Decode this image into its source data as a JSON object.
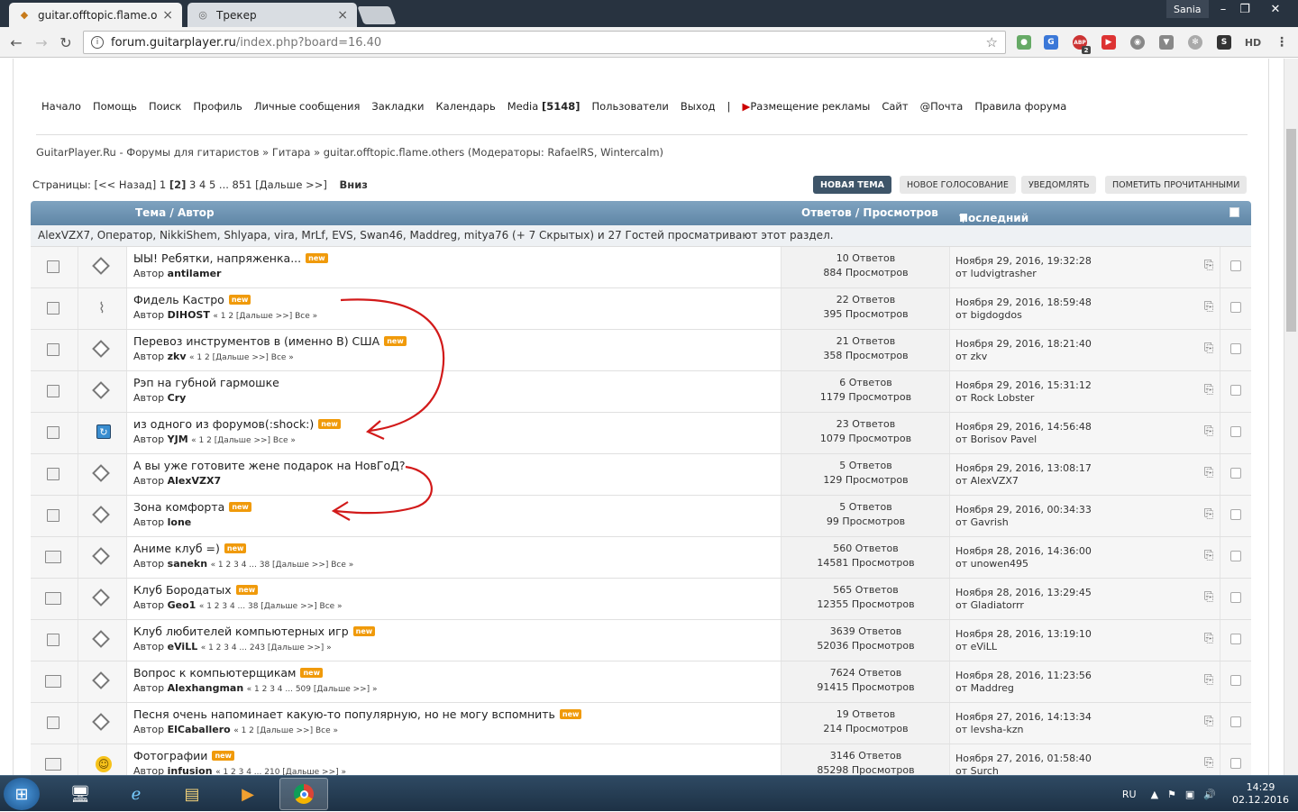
{
  "browser": {
    "tabs": [
      {
        "title": "guitar.offtopic.flame.othe",
        "active": true
      },
      {
        "title": "Трекер",
        "active": false
      }
    ],
    "user": "Sania",
    "url_host": "forum.guitarplayer.ru",
    "url_path": "/index.php?board=16.40",
    "ext_hd": "HD",
    "ext_abp": "ABP",
    "ext_abp_count": "2"
  },
  "menu": {
    "items": [
      "Начало",
      "Помощь",
      "Поиск",
      "Профиль",
      "Личные сообщения",
      "Закладки",
      "Календарь"
    ],
    "media_label": "Media",
    "media_count": "[5148]",
    "items2": [
      "Пользователи",
      "Выход"
    ],
    "sep": "|",
    "ads": "Размещение рекламы",
    "items3": [
      "Сайт",
      "@Почта",
      "Правила форума"
    ]
  },
  "breadcrumb": "GuitarPlayer.Ru - Форумы для гитаристов » Гитара » guitar.offtopic.flame.others (Модераторы: RafaelRS, Wintercalm)",
  "pagination": {
    "prefix": "Страницы: [<< Назад] 1 ",
    "current": "[2]",
    "rest": " 3 4 5 ... 851 [Дальше >>]",
    "down": "Вниз"
  },
  "buttons": {
    "new_topic": "НОВАЯ ТЕМА",
    "new_poll": "НОВОЕ ГОЛОСОВАНИЕ",
    "notify": "УВЕДОМЛЯТЬ",
    "mark_read": "ПОМЕТИТЬ ПРОЧИТАННЫМИ"
  },
  "table": {
    "col_topic": "Тема / Автор",
    "col_stats": "Ответов / Просмотров",
    "col_last": "Последний ответ",
    "viewers": "AlexVZX7, Оператор, NikkiShem, Shlyapa, vira, MrLf, EVS, Swan46, Maddreg, mitya76 (+ 7 Скрытых) и 27 Гостей просматривают этот раздел.",
    "author_prefix": "Автор",
    "new_badge": "new"
  },
  "topics": [
    {
      "title": "ЫЫ! Ребятки, напряженка...",
      "new": true,
      "author": "antilamer",
      "pages": "",
      "replies": "10 Ответов",
      "views": "884 Просмотров",
      "date": "Ноября 29, 2016, 19:32:28",
      "by": "от ludvigtrasher",
      "icon1": "doc",
      "icon2": "diamond"
    },
    {
      "title": "Фидель Кастро",
      "new": true,
      "author": "DIHOST",
      "pages": "« 1 2 [Дальше >>]   Все »",
      "replies": "22 Ответов",
      "views": "395 Просмотров",
      "date": "Ноября 29, 2016, 18:59:48",
      "by": "от bigdogdos",
      "icon1": "doc",
      "icon2": "clip"
    },
    {
      "title": "Перевоз инструментов в (именно В) США",
      "new": true,
      "author": "zkv",
      "pages": "« 1 2 [Дальше >>]   Все »",
      "replies": "21 Ответов",
      "views": "358 Просмотров",
      "date": "Ноября 29, 2016, 18:21:40",
      "by": "от zkv",
      "icon1": "doc",
      "icon2": "diamond"
    },
    {
      "title": "Рэп на губной гармошке",
      "new": false,
      "author": "Cry",
      "pages": "",
      "replies": "6 Ответов",
      "views": "1179 Просмотров",
      "date": "Ноября 29, 2016, 15:31:12",
      "by": "от Rock Lobster",
      "icon1": "doc",
      "icon2": "diamond"
    },
    {
      "title": "из одного из форумов(:shock:)",
      "new": true,
      "author": "YJM",
      "pages": "« 1 2 [Дальше >>]   Все »",
      "replies": "23 Ответов",
      "views": "1079 Просмотров",
      "date": "Ноября 29, 2016, 14:56:48",
      "by": "от Borisov Pavel",
      "icon1": "doc",
      "icon2": "refresh"
    },
    {
      "title": "А вы уже готовите жене подарок на НовГоД?",
      "new": false,
      "author": "AlexVZX7",
      "pages": "",
      "replies": "5 Ответов",
      "views": "129 Просмотров",
      "date": "Ноября 29, 2016, 13:08:17",
      "by": "от AlexVZX7",
      "icon1": "doc",
      "icon2": "diamond"
    },
    {
      "title": "Зона комфорта",
      "new": true,
      "author": "lone",
      "pages": "",
      "replies": "5 Ответов",
      "views": "99 Просмотров",
      "date": "Ноября 29, 2016, 00:34:33",
      "by": "от Gavrish",
      "icon1": "doc",
      "icon2": "diamond"
    },
    {
      "title": "Аниме клуб =)",
      "new": true,
      "author": "sanekn",
      "pages": "« 1 2 3 4 ... 38 [Дальше >>]   Все »",
      "replies": "560 Ответов",
      "views": "14581 Просмотров",
      "date": "Ноября 28, 2016, 14:36:00",
      "by": "от unowen495",
      "icon1": "big",
      "icon2": "diamond"
    },
    {
      "title": "Клуб Бородатых",
      "new": true,
      "author": "Geo1",
      "pages": "« 1 2 3 4 ... 38 [Дальше >>]   Все »",
      "replies": "565 Ответов",
      "views": "12355 Просмотров",
      "date": "Ноября 28, 2016, 13:29:45",
      "by": "от Gladiatorrr",
      "icon1": "big",
      "icon2": "diamond"
    },
    {
      "title": "Клуб любителей компьютерных игр",
      "new": true,
      "author": "eViLL",
      "pages": "« 1 2 3 4 ... 243 [Дальше >>]   »",
      "replies": "3639 Ответов",
      "views": "52036 Просмотров",
      "date": "Ноября 28, 2016, 13:19:10",
      "by": "от eViLL",
      "icon1": "doc",
      "icon2": "diamond"
    },
    {
      "title": "Вопрос к компьютерщикам",
      "new": true,
      "author": "Alexhangman",
      "pages": "« 1 2 3 4 ... 509 [Дальше >>]   »",
      "replies": "7624 Ответов",
      "views": "91415 Просмотров",
      "date": "Ноября 28, 2016, 11:23:56",
      "by": "от Maddreg",
      "icon1": "big",
      "icon2": "diamond"
    },
    {
      "title": "Песня очень напоминает какую-то популярную, но не могу вспомнить",
      "new": true,
      "author": "ElCaballero",
      "pages": "« 1 2 [Дальше >>]   Все »",
      "replies": "19 Ответов",
      "views": "214 Просмотров",
      "date": "Ноября 27, 2016, 14:13:34",
      "by": "от levsha-kzn",
      "icon1": "doc",
      "icon2": "diamond"
    },
    {
      "title": "Фотографии",
      "new": true,
      "author": "infusion",
      "pages": "« 1 2 3 4 ... 210 [Дальше >>]   »",
      "replies": "3146 Ответов",
      "views": "85298 Просмотров",
      "date": "Ноября 27, 2016, 01:58:40",
      "by": "от Surch",
      "icon1": "big",
      "icon2": "smile"
    }
  ],
  "taskbar": {
    "lang": "RU",
    "time": "14:29",
    "date": "02.12.2016"
  },
  "colors": {
    "annotation": "#d21a1a",
    "header": "#6a8fae",
    "new_badge": "#f09a0a"
  }
}
